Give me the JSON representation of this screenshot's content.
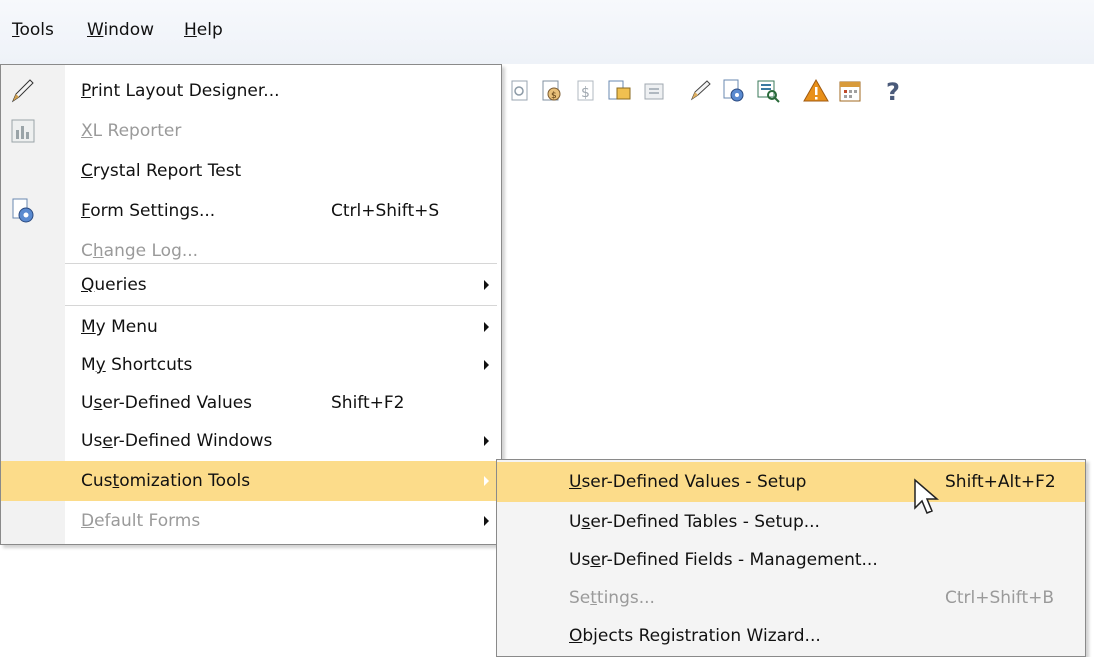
{
  "menubar": {
    "items": [
      {
        "pre": "",
        "mn": "T",
        "post": "ools"
      },
      {
        "pre": "",
        "mn": "W",
        "post": "indow"
      },
      {
        "pre": "",
        "mn": "H",
        "post": "elp"
      }
    ]
  },
  "toolbar": {
    "icons": [
      "refresh-doc-icon",
      "cost-doc-icon",
      "pound-doc-icon",
      "stack-doc-icon",
      "folder-icon",
      "pencil-icon",
      "gear-doc-icon",
      "preview-icon",
      "warning-icon",
      "calendar-icon",
      "help-icon"
    ]
  },
  "tools_menu": {
    "items": [
      {
        "pre": "",
        "mn": "P",
        "post": "rint Layout Designer...",
        "shortcut": "",
        "icon": "pencil-icon"
      },
      {
        "pre": "",
        "mn": "X",
        "post": "L Reporter",
        "shortcut": "",
        "icon": "xl-reporter-icon"
      },
      {
        "pre": "",
        "mn": "C",
        "post": "rystal Report Test",
        "shortcut": ""
      },
      {
        "pre": "",
        "mn": "F",
        "post": "orm Settings...",
        "shortcut": "Ctrl+Shift+S",
        "icon": "form-settings-icon"
      },
      {
        "pre": "C",
        "mn": "h",
        "post": "ange Log...",
        "shortcut": ""
      },
      {
        "pre": "",
        "mn": "Q",
        "post": "ueries",
        "shortcut": ""
      },
      {
        "pre": "",
        "mn": "M",
        "post": "y Menu",
        "shortcut": ""
      },
      {
        "pre": "M",
        "mn": "y",
        "post": " Shortcuts",
        "shortcut": ""
      },
      {
        "pre": "U",
        "mn": "s",
        "post": "er-Defined Values",
        "shortcut": "Shift+F2"
      },
      {
        "pre": "Us",
        "mn": "e",
        "post": "r-Defined Windows",
        "shortcut": ""
      },
      {
        "pre": "Cus",
        "mn": "t",
        "post": "omization Tools",
        "shortcut": ""
      },
      {
        "pre": "",
        "mn": "D",
        "post": "efault Forms",
        "shortcut": ""
      }
    ]
  },
  "customization_submenu": {
    "items": [
      {
        "pre": "",
        "mn": "U",
        "post": "ser-Defined Values - Setup",
        "shortcut": "Shift+Alt+F2"
      },
      {
        "pre": "U",
        "mn": "s",
        "post": "er-Defined Tables - Setup...",
        "shortcut": ""
      },
      {
        "pre": "Us",
        "mn": "e",
        "post": "r-Defined Fields - Management...",
        "shortcut": ""
      },
      {
        "pre": "Se",
        "mn": "t",
        "post": "tings...",
        "shortcut": "Ctrl+Shift+B"
      },
      {
        "pre": "",
        "mn": "O",
        "post": "bjects Registration Wizard...",
        "shortcut": ""
      }
    ]
  }
}
